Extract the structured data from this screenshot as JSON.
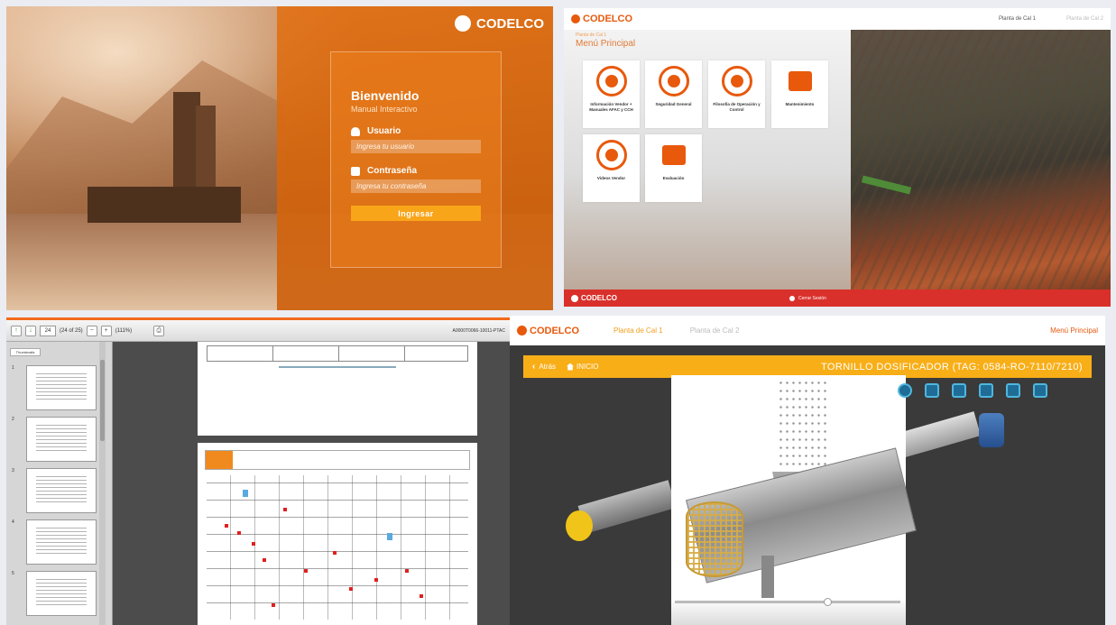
{
  "login": {
    "logo": "CODELCO",
    "welcome": "Bienvenido",
    "subtitle": "Manual Interactivo",
    "user_label": "Usuario",
    "user_placeholder": "Ingresa tu usuario",
    "password_label": "Contraseña",
    "password_placeholder": "Ingresa tu contraseña",
    "submit": "Ingresar"
  },
  "menu": {
    "logo": "CODELCO",
    "tabs": [
      "Planta de Cal 1",
      "Planta de Cal 2"
    ],
    "breadcrumb": "Planta de Cal 1",
    "heading": "Menú Principal",
    "tiles": [
      {
        "label": "Información Vendor + Manuales AFAC y CCH",
        "icon": "gear-icon"
      },
      {
        "label": "Seguridad General",
        "icon": "gear-icon"
      },
      {
        "label": "Filosofía de Operación y Control",
        "icon": "gear-icon"
      },
      {
        "label": "Mantenimiento",
        "icon": "calendar-icon"
      },
      {
        "label": "Videos Vendor",
        "icon": "film-reel-icon"
      },
      {
        "label": "Evaluación",
        "icon": "worker-clipboard-icon"
      }
    ],
    "footer_logo": "CODELCO",
    "logout": "Cerrar Sesión",
    "accent": "#e8590c",
    "footer_color": "#d9302b"
  },
  "pdf": {
    "page_input": "24",
    "page_count": "(24 of 25)",
    "zoom": "(111%)",
    "doc_id": "A0000T0066-10011-PTAC",
    "sidebar_tab": "Thumbnails",
    "thumbnails": [
      "1",
      "2",
      "3",
      "4",
      "5"
    ]
  },
  "viewer": {
    "logo": "CODELCO",
    "tab1": "Planta de Cal 1",
    "tab2": "Planta de Cal 2",
    "main_menu": "Menú Principal",
    "back": "Atrás",
    "home": "INICIO",
    "title": "TORNILLO DOSIFICADOR (TAG: 0584-RO-7110/7210)",
    "accent": "#f8ae17"
  }
}
